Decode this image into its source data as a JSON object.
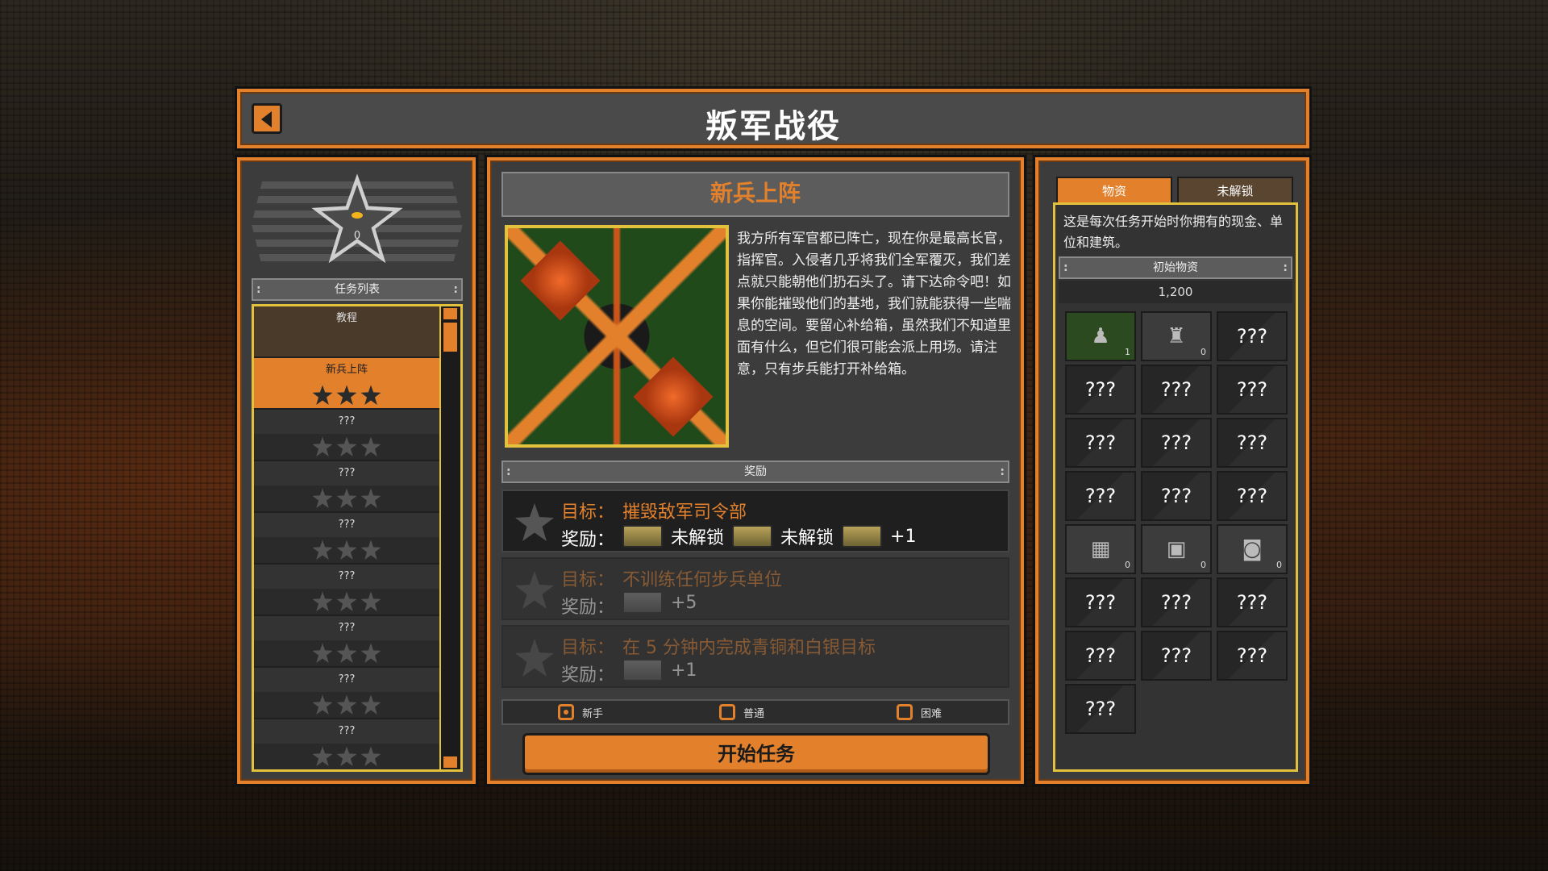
{
  "header": {
    "title": "叛军战役"
  },
  "left_panel": {
    "star_count": "0",
    "list_title": "任务列表",
    "missions": [
      {
        "name": "教程",
        "state": "tutorial",
        "stars": 0
      },
      {
        "name": "新兵上阵",
        "state": "active",
        "stars": 3
      },
      {
        "name": "???",
        "state": "locked",
        "stars": 3
      },
      {
        "name": "???",
        "state": "locked",
        "stars": 3
      },
      {
        "name": "???",
        "state": "locked",
        "stars": 3
      },
      {
        "name": "???",
        "state": "locked",
        "stars": 3
      },
      {
        "name": "???",
        "state": "locked",
        "stars": 3
      },
      {
        "name": "???",
        "state": "locked",
        "stars": 3
      },
      {
        "name": "???",
        "state": "locked",
        "stars": 3
      }
    ]
  },
  "center_panel": {
    "mission_title": "新兵上阵",
    "description": "我方所有军官都已阵亡，现在你是最高长官，指挥官。入侵者几乎将我们全军覆灭，我们差点就只能朝他们扔石头了。请下达命令吧！如果你能摧毁他们的基地，我们就能获得一些喘息的空间。要留心补给箱，虽然我们不知道里面有什么，但它们很可能会派上用场。请注意，只有步兵能打开补给箱。",
    "rewards_title": "奖励",
    "goal_label": "目标：",
    "reward_label": "奖励：",
    "objectives": [
      {
        "goal": "摧毁敌军司令部",
        "rewards": [
          "未解锁",
          "未解锁",
          "+1"
        ]
      },
      {
        "goal": "不训练任何步兵单位",
        "rewards": [
          "+5"
        ]
      },
      {
        "goal": "在 5 分钟内完成青铜和白银目标",
        "rewards": [
          "+1"
        ]
      }
    ],
    "difficulty": [
      {
        "label": "新手",
        "selected": true
      },
      {
        "label": "普通",
        "selected": false
      },
      {
        "label": "困难",
        "selected": false
      }
    ],
    "start_button": "开始任务"
  },
  "right_panel": {
    "tabs": [
      "物资",
      "未解锁"
    ],
    "description": "这是每次任务开始时你拥有的现金、单位和建筑。",
    "supplies_title": "初始物资",
    "supplies_value": "1,200",
    "grid": [
      {
        "label": "",
        "count": "1",
        "icon": "soldier-icon"
      },
      {
        "label": "",
        "count": "0",
        "icon": "robot-icon"
      },
      {
        "label": "???",
        "count": ""
      },
      {
        "label": "???",
        "count": ""
      },
      {
        "label": "???",
        "count": ""
      },
      {
        "label": "???",
        "count": ""
      },
      {
        "label": "???",
        "count": ""
      },
      {
        "label": "???",
        "count": ""
      },
      {
        "label": "???",
        "count": ""
      },
      {
        "label": "???",
        "count": ""
      },
      {
        "label": "???",
        "count": ""
      },
      {
        "label": "???",
        "count": ""
      },
      {
        "label": "",
        "count": "0",
        "icon": "factory-icon"
      },
      {
        "label": "",
        "count": "0",
        "icon": "barracks-icon"
      },
      {
        "label": "",
        "count": "0",
        "icon": "hangar-icon"
      },
      {
        "label": "???",
        "count": ""
      },
      {
        "label": "???",
        "count": ""
      },
      {
        "label": "???",
        "count": ""
      },
      {
        "label": "???",
        "count": ""
      },
      {
        "label": "???",
        "count": ""
      },
      {
        "label": "???",
        "count": ""
      },
      {
        "label": "???",
        "count": ""
      }
    ]
  },
  "colors": {
    "accent": "#e2802c",
    "highlight": "#e2c23c",
    "panel": "#3c3c3c"
  }
}
